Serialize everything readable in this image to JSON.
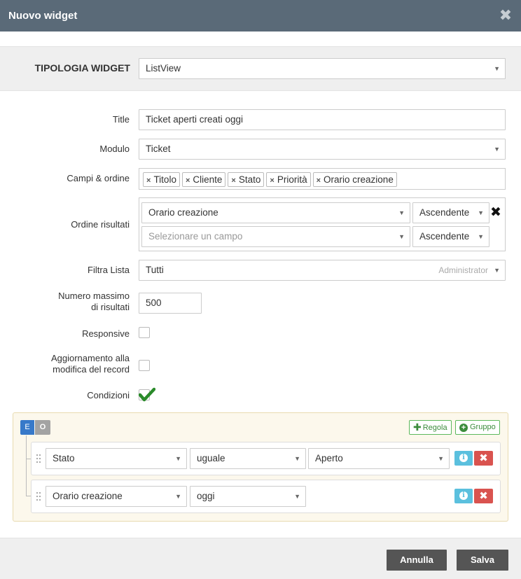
{
  "dialog": {
    "title": "Nuovo widget"
  },
  "type": {
    "label": "TIPOLOGIA WIDGET",
    "value": "ListView"
  },
  "form": {
    "title": {
      "label": "Title",
      "value": "Ticket aperti creati oggi"
    },
    "module": {
      "label": "Modulo",
      "value": "Ticket"
    },
    "fields": {
      "label": "Campi & ordine",
      "tags": [
        "Titolo",
        "Cliente",
        "Stato",
        "Priorità",
        "Orario creazione"
      ]
    },
    "order": {
      "label": "Ordine risultati",
      "rows": [
        {
          "field": "Orario creazione",
          "direction": "Ascendente"
        },
        {
          "field_placeholder": "Selezionare un campo",
          "direction": "Ascendente"
        }
      ]
    },
    "filter": {
      "label": "Filtra Lista",
      "value": "Tutti",
      "hint": "Administrator"
    },
    "max_results": {
      "label_line1": "Numero massimo",
      "label_line2": "di risultati",
      "value": "500"
    },
    "responsive": {
      "label": "Responsive",
      "checked": false
    },
    "update_on_edit": {
      "label_line1": "Aggiornamento alla",
      "label_line2": "modifica del record",
      "checked": false
    },
    "conditions": {
      "label": "Condizioni",
      "checked": true
    }
  },
  "query_builder": {
    "and_label": "E",
    "or_label": "O",
    "add_rule_label": "Regola",
    "add_group_label": "Gruppo",
    "rules": [
      {
        "field": "Stato",
        "operator": "uguale",
        "value": "Aperto"
      },
      {
        "field": "Orario creazione",
        "operator": "oggi"
      }
    ]
  },
  "footer": {
    "cancel_label": "Annulla",
    "save_label": "Salva"
  },
  "colors": {
    "header": "#5a6a78",
    "and_active": "#3779c9",
    "add_button": "#5cb85c",
    "info": "#5bc0de",
    "delete": "#d9534f",
    "check": "#2a8a2a",
    "footer_button": "#555555"
  },
  "icons": {
    "close": "close-icon",
    "tag_remove": "x-icon",
    "arrow": "caret-down-icon",
    "check": "checkmark-icon",
    "add": "plus-icon",
    "info": "info-icon",
    "delete": "x-icon",
    "drag": "drag-handle-icon"
  }
}
